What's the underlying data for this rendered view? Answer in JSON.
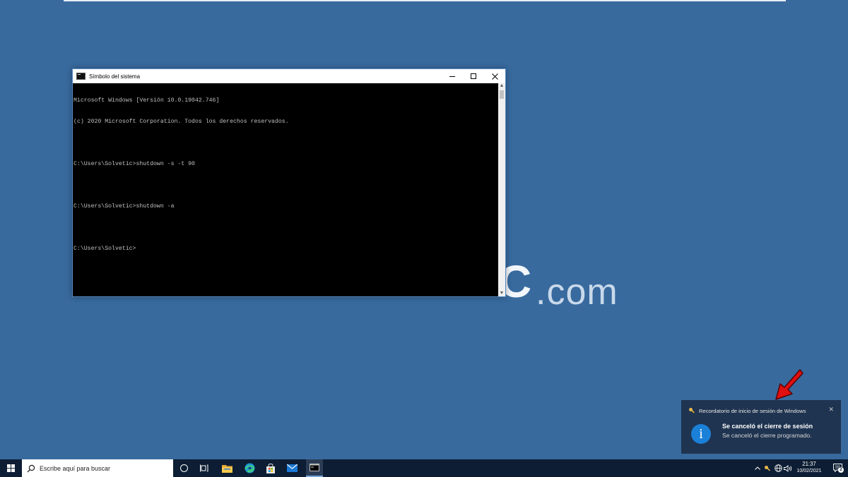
{
  "wallpaper": {
    "logo_letter": "C",
    "logo_suffix": ".com"
  },
  "cmd_window": {
    "title": "Símbolo del sistema",
    "lines": [
      "Microsoft Windows [Versión 10.0.19042.746]",
      "(c) 2020 Microsoft Corporation. Todos los derechos reservados.",
      "",
      "C:\\Users\\Solvetic>shutdown -s -t 90",
      "",
      "C:\\Users\\Solvetic>shutdown -a",
      "",
      "C:\\Users\\Solvetic>"
    ],
    "controls": [
      "minimize-icon",
      "maximize-icon",
      "close-icon"
    ]
  },
  "toast": {
    "app_name": "Recordatorio de inicio de sesión de Windows",
    "title": "Se canceló el cierre de sesión",
    "body": "Se canceló el cierre programado.",
    "info_glyph": "i",
    "close_glyph": "✕"
  },
  "taskbar": {
    "search_placeholder": "Escribe aquí para buscar",
    "pinned": [
      "cortana-icon",
      "task-view-icon",
      "file-explorer-icon",
      "edge-icon",
      "store-icon",
      "mail-icon",
      "command-prompt-icon"
    ],
    "clock_time": "21:37",
    "clock_date": "10/02/2021",
    "notification_count": "2"
  },
  "colors": {
    "desktop": "#386a9e",
    "taskbar": "#0d1d33",
    "toast": "#1f3450",
    "info_accent": "#1a80d8",
    "arrow": "#e01010"
  }
}
